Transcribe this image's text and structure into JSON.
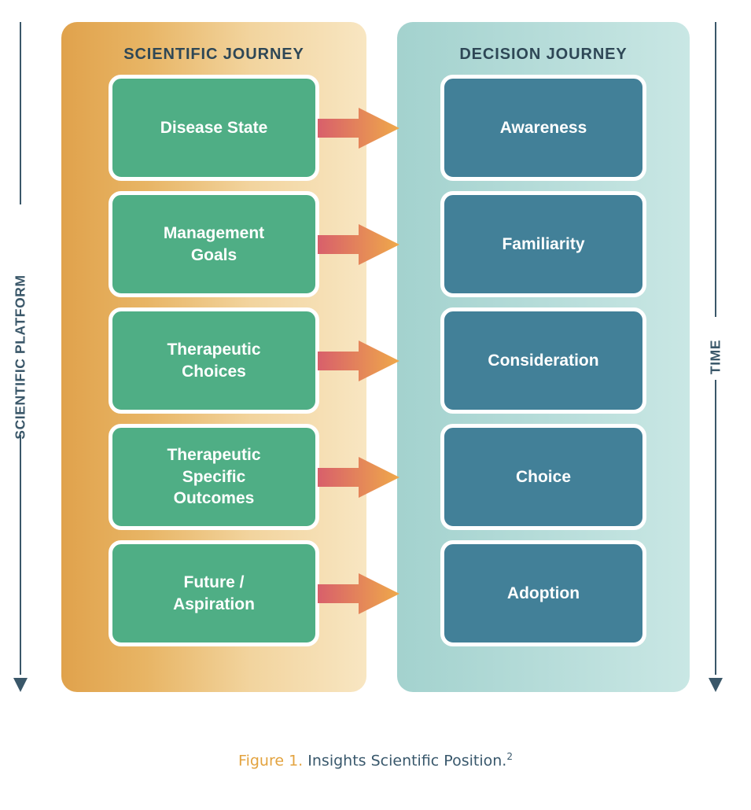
{
  "figure": {
    "caption_label": "Figure 1.",
    "caption_text": "Insights Scientific Position.",
    "caption_reference": "2"
  },
  "axes": {
    "left": {
      "label": "SCIENTIFIC PLATFORM",
      "icon": "down-arrow-icon",
      "direction": "down"
    },
    "right": {
      "label": "TIME",
      "icon": "down-arrow-icon",
      "direction": "down"
    }
  },
  "panels": {
    "scientific": {
      "heading": "SCIENTIFIC JOURNEY",
      "gradient_from": "#E0A24C",
      "gradient_to": "#F8E6C2",
      "node_color": "#4FAE85",
      "nodes": [
        {
          "label": "Disease State"
        },
        {
          "label": "Management\nGoals"
        },
        {
          "label": "Therapeutic\nChoices"
        },
        {
          "label": "Therapeutic\nSpecific\nOutcomes"
        },
        {
          "label": "Future /\nAspiration"
        }
      ]
    },
    "decision": {
      "heading": "DECISION JOURNEY",
      "gradient_from": "#A3D2CE",
      "gradient_to": "#C9E7E4",
      "node_color": "#428098",
      "nodes": [
        {
          "label": "Awareness"
        },
        {
          "label": "Familiarity"
        },
        {
          "label": "Consideration"
        },
        {
          "label": "Choice"
        },
        {
          "label": "Adoption"
        }
      ]
    }
  },
  "connectors": {
    "count": 5,
    "icon": "right-arrow-icon",
    "gradient_from": "#D85F6B",
    "gradient_to": "#EFA94A"
  },
  "colors": {
    "text_dark": "#2E4756",
    "text_on_node": "#FFFFFF",
    "caption_accent": "#E3A33F",
    "axis": "#3A5769",
    "background": "#FFFFFF"
  }
}
